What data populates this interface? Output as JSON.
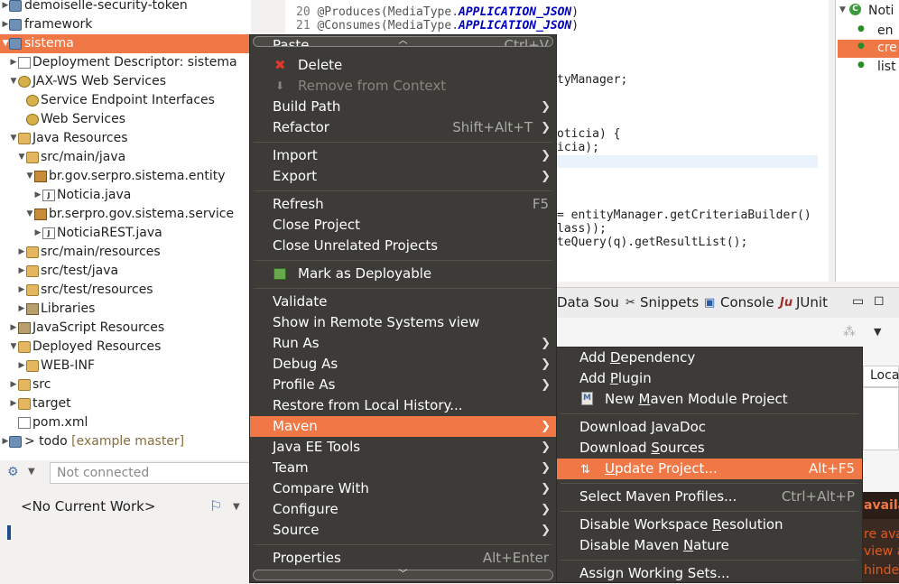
{
  "explorer": {
    "rows": [
      {
        "label": "demoiselle-security-token",
        "hint": ""
      },
      {
        "label": "framework",
        "hint": ""
      },
      {
        "label": "sistema",
        "hint": ""
      },
      {
        "label": "Deployment Descriptor: sistema",
        "hint": ""
      },
      {
        "label": "JAX-WS Web Services",
        "hint": ""
      },
      {
        "label": "Service Endpoint Interfaces",
        "hint": ""
      },
      {
        "label": "Web Services",
        "hint": ""
      },
      {
        "label": "Java Resources",
        "hint": ""
      },
      {
        "label": "src/main/java",
        "hint": ""
      },
      {
        "label": "br.gov.serpro.sistema.entity",
        "hint": ""
      },
      {
        "label": "Noticia.java",
        "hint": ""
      },
      {
        "label": "br.serpro.gov.sistema.service",
        "hint": ""
      },
      {
        "label": "NoticiaREST.java",
        "hint": ""
      },
      {
        "label": "src/main/resources",
        "hint": ""
      },
      {
        "label": "src/test/java",
        "hint": ""
      },
      {
        "label": "src/test/resources",
        "hint": ""
      },
      {
        "label": "Libraries",
        "hint": ""
      },
      {
        "label": "JavaScript Resources",
        "hint": ""
      },
      {
        "label": "Deployed Resources",
        "hint": ""
      },
      {
        "label": "WEB-INF",
        "hint": ""
      },
      {
        "label": "src",
        "hint": ""
      },
      {
        "label": "target",
        "hint": ""
      },
      {
        "label": "pom.xml",
        "hint": ""
      },
      {
        "label": "> todo",
        "hint": "[example master]"
      }
    ]
  },
  "task_panel": {
    "connection_placeholder": "Not connected",
    "current_work": "<No Current Work>"
  },
  "editor": {
    "lines": [
      {
        "num": "20",
        "pre": "@Produces(MediaType.",
        "kw": "APPLICATION_JSON",
        "post": ")"
      },
      {
        "num": "21",
        "pre": "@Consumes(MediaType.",
        "kw": "APPLICATION_JSON",
        "post": ")"
      }
    ],
    "frag_manager": "tyManager;",
    "frag_noticia1": "oticia) {",
    "frag_noticia2": "icia);",
    "frag_builder": "= entityManager.getCriteriaBuilder()",
    "frag_class": "lass));",
    "frag_query": "teQuery(q).getResultList();"
  },
  "outline": {
    "header": "Noti",
    "items": [
      "en",
      "cre",
      "list"
    ]
  },
  "views": {
    "tabs": [
      "Data Sou",
      "Snippets",
      "Console",
      "JUnit"
    ],
    "column_header": "Loca",
    "warnings": [
      "availab",
      "re avai",
      "view ar",
      "hinder"
    ]
  },
  "context_menu": {
    "items": [
      {
        "label": "Paste",
        "accel": "Ctrl+V"
      },
      {
        "label": "Delete",
        "accel": ""
      },
      {
        "label": "Remove from Context",
        "accel": ""
      },
      {
        "label": "Build Path",
        "accel": ""
      },
      {
        "label": "Refactor",
        "accel": "Shift+Alt+T"
      },
      {
        "label": "Import",
        "accel": ""
      },
      {
        "label": "Export",
        "accel": ""
      },
      {
        "label": "Refresh",
        "accel": "F5"
      },
      {
        "label": "Close Project",
        "accel": ""
      },
      {
        "label": "Close Unrelated Projects",
        "accel": ""
      },
      {
        "label": "Mark as Deployable",
        "accel": ""
      },
      {
        "label": "Validate",
        "accel": ""
      },
      {
        "label": "Show in Remote Systems view",
        "accel": ""
      },
      {
        "label": "Run As",
        "accel": ""
      },
      {
        "label": "Debug As",
        "accel": ""
      },
      {
        "label": "Profile As",
        "accel": ""
      },
      {
        "label": "Restore from Local History...",
        "accel": ""
      },
      {
        "label": "Maven",
        "accel": ""
      },
      {
        "label": "Java EE Tools",
        "accel": ""
      },
      {
        "label": "Team",
        "accel": ""
      },
      {
        "label": "Compare With",
        "accel": ""
      },
      {
        "label": "Configure",
        "accel": ""
      },
      {
        "label": "Source",
        "accel": ""
      },
      {
        "label": "Properties",
        "accel": "Alt+Enter"
      }
    ]
  },
  "maven_menu": {
    "items": [
      {
        "pre": "Add ",
        "u": "D",
        "post": "ependency",
        "accel": ""
      },
      {
        "pre": "Add ",
        "u": "P",
        "post": "lugin",
        "accel": ""
      },
      {
        "pre": "New ",
        "u": "M",
        "post": "aven Module Project",
        "accel": ""
      },
      {
        "pre": "Download ",
        "u": "J",
        "post": "avaDoc",
        "accel": ""
      },
      {
        "pre": "Download ",
        "u": "S",
        "post": "ources",
        "accel": ""
      },
      {
        "pre": "",
        "u": "U",
        "post": "pdate Project...",
        "accel": "Alt+F5"
      },
      {
        "pre": "Select Maven Profiles...",
        "u": "",
        "post": "",
        "accel": "Ctrl+Alt+P"
      },
      {
        "pre": "Disable Workspace ",
        "u": "R",
        "post": "esolution",
        "accel": ""
      },
      {
        "pre": "Disable Maven ",
        "u": "N",
        "post": "ature",
        "accel": ""
      },
      {
        "pre": "Assign Working Sets...",
        "u": "",
        "post": "",
        "accel": ""
      }
    ]
  },
  "colors": {
    "accent": "#f07746",
    "menu_bg": "#3c3b37"
  }
}
